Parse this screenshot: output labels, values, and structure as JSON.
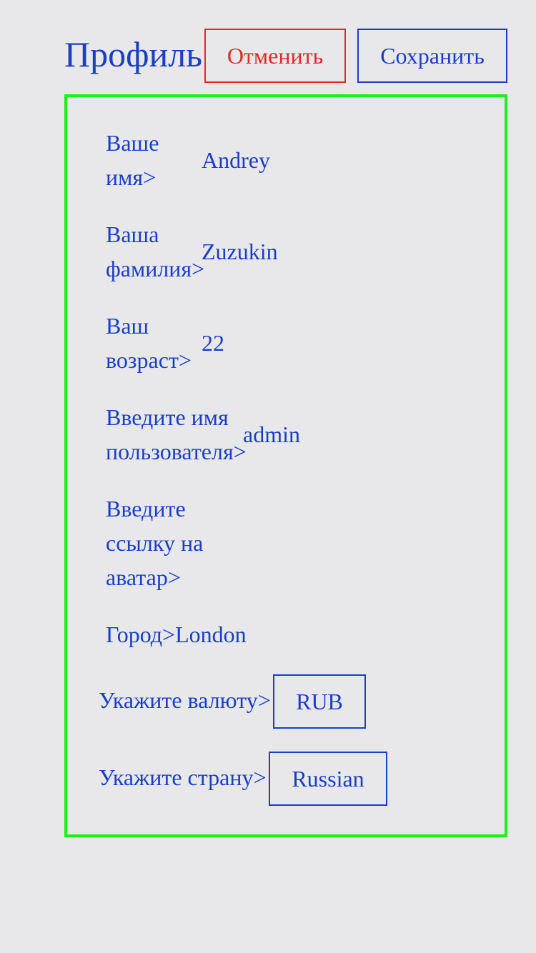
{
  "header": {
    "title": "Профиль",
    "cancel_label": "Отменить",
    "save_label": "Сохранить"
  },
  "form": {
    "first_name": {
      "label_line1": "Ваше",
      "label_line2": "имя>",
      "value": "Andrey"
    },
    "last_name": {
      "label_line1": "Ваша",
      "label_line2": "фамилия>",
      "value": "Zuzukin"
    },
    "age": {
      "label_line1": "Ваш",
      "label_line2": "возраст>",
      "value": "22"
    },
    "username": {
      "label_line1": "Введите имя",
      "label_line2": "пользователя>",
      "value": "admin"
    },
    "avatar": {
      "label_line1": "Введите",
      "label_line2": "ссылку на",
      "label_line3": "аватар>",
      "value": ""
    },
    "city": {
      "label": "Город>",
      "value": "London"
    },
    "currency": {
      "label": "Укажите валюту>",
      "value": "RUB"
    },
    "country": {
      "label": "Укажите страну>",
      "value": "Russian"
    }
  },
  "colors": {
    "text": "#1a3fc4",
    "cancel": "#e02a2a",
    "panel_border": "#1ef01e",
    "background": "#e8e8ea"
  }
}
